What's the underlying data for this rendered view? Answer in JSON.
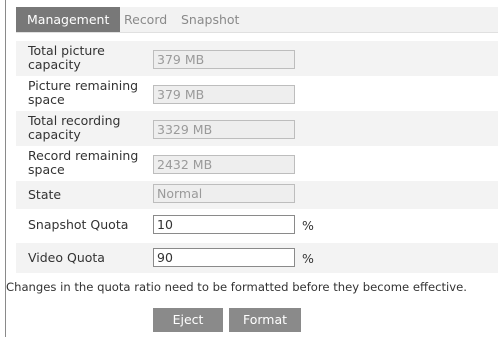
{
  "tabs": [
    {
      "label": "Management",
      "active": true
    },
    {
      "label": "Record",
      "active": false
    },
    {
      "label": "Snapshot",
      "active": false
    }
  ],
  "fields": {
    "total_picture_capacity": {
      "label": "Total picture capacity",
      "value": "379 MB"
    },
    "picture_remaining_space": {
      "label": "Picture remaining space",
      "value": "379 MB"
    },
    "total_recording_capacity": {
      "label": "Total recording capacity",
      "value": "3329 MB"
    },
    "record_remaining_space": {
      "label": "Record remaining space",
      "value": "2432 MB"
    },
    "state": {
      "label": "State",
      "value": "Normal"
    },
    "snapshot_quota": {
      "label": "Snapshot Quota",
      "value": "10",
      "unit": "%"
    },
    "video_quota": {
      "label": "Video Quota",
      "value": "90",
      "unit": "%"
    }
  },
  "note": "Changes in the quota ratio need to be formatted before they become effective.",
  "buttons": {
    "eject": "Eject",
    "format": "Format"
  },
  "colors": {
    "active_tab": "#787878",
    "button": "#8a8a8a",
    "row_shade": "#f3f3f3"
  }
}
